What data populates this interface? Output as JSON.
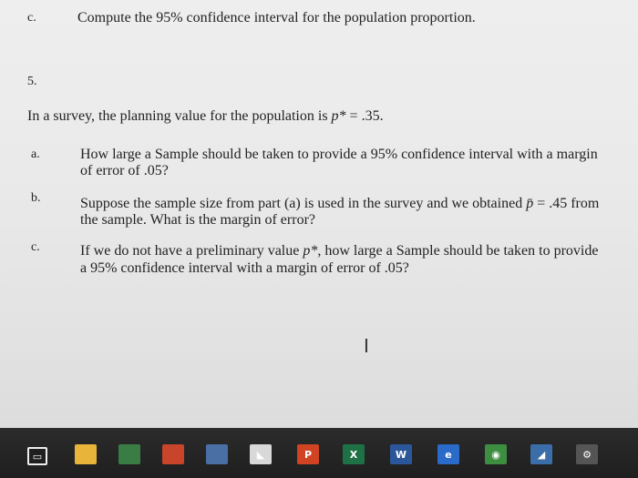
{
  "document": {
    "line_c_top_label": "c.",
    "line_c_top_text": "Compute the 95% confidence interval for the population proportion.",
    "q5_label": "5.",
    "q5_intro_part1": "In a survey, the planning value for the population is ",
    "q5_intro_var": "p*",
    "q5_intro_part2": " = .35.",
    "a_label": "a.",
    "a_line1": "How large a Sample should be taken to provide a 95% confidence interval with a margin",
    "a_line2": "of error of .05?",
    "b_label": "b.",
    "b_line1_part1": "Suppose the sample size from part (a) is used in the survey and we obtained ",
    "b_line1_var": "p̄",
    "b_line1_part2": " = .45 from",
    "b_line2": "the sample.  What is the margin of error?",
    "c_label": "c.",
    "c_line1_part1": "If we do not have a preliminary value ",
    "c_line1_var": "p*",
    "c_line1_part2": ", how large a Sample should be taken to provide",
    "c_line2": "a 95% confidence interval with a margin of error of .05?"
  },
  "cursor": {
    "glyph": "I"
  },
  "taskbar": {
    "icons": [
      {
        "name": "task-view-icon",
        "color": "#1f1f1f",
        "text": "▭"
      },
      {
        "name": "file-explorer-icon",
        "color": "#e8b43a",
        "text": ""
      },
      {
        "name": "excel-icon-1",
        "color": "#3a7d44",
        "text": ""
      },
      {
        "name": "calculator-icon",
        "color": "#c8452b",
        "text": ""
      },
      {
        "name": "photos-icon",
        "color": "#4a6fa5",
        "text": ""
      },
      {
        "name": "mail-icon",
        "color": "#d8d8d8",
        "text": "◣"
      },
      {
        "name": "powerpoint-icon",
        "color": "#d04423",
        "text": "P"
      },
      {
        "name": "excel-icon-2",
        "color": "#1e7145",
        "text": "X"
      },
      {
        "name": "word-icon",
        "color": "#2b579a",
        "text": "W"
      },
      {
        "name": "edge-icon",
        "color": "#2a6ac8",
        "text": "e"
      },
      {
        "name": "chrome-icon",
        "color": "#3d8e41",
        "text": "◉"
      },
      {
        "name": "store-icon",
        "color": "#3b6ea8",
        "text": "◢"
      },
      {
        "name": "settings-icon",
        "color": "#555555",
        "text": "⚙"
      }
    ]
  }
}
